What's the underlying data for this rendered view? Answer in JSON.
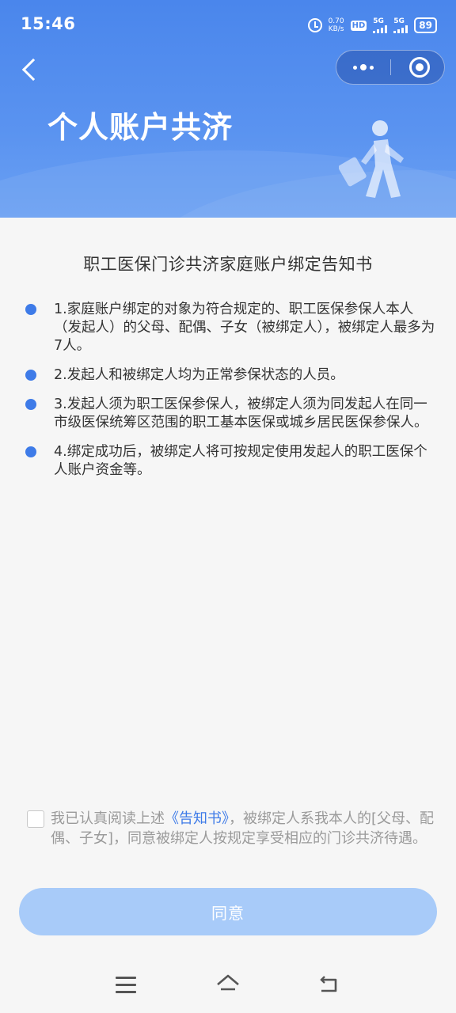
{
  "status_bar": {
    "time": "15:46",
    "net_speed_value": "0.70",
    "net_speed_unit": "KB/s",
    "hd_label": "HD",
    "sim1_label": "5G",
    "sim2_label": "5G",
    "battery": "89"
  },
  "header": {
    "title": "个人账户共济",
    "background_color": "#4a86ec"
  },
  "notice": {
    "title": "职工医保门诊共济家庭账户绑定告知书",
    "items": [
      "1.家庭账户绑定的对象为符合规定的、职工医保参保人本人（发起人）的父母、配偶、子女（被绑定人），被绑定人最多为7人。",
      "2.发起人和被绑定人均为正常参保状态的人员。",
      "3.发起人须为职工医保参保人，被绑定人须为同发起人在同一市级医保统筹区范围的职工基本医保或城乡居民医保参保人。",
      "4.绑定成功后，被绑定人将可按规定使用发起人的职工医保个人账户资金等。"
    ]
  },
  "agreement": {
    "text_before": "我已认真阅读上述",
    "link_text": "《告知书》",
    "text_after": "，被绑定人系我本人的[父母、配偶、子女]，同意被绑定人按规定享受相应的门诊共济待遇。",
    "checked": false
  },
  "primary_button": {
    "label": "同意",
    "color": "#a8cbf9"
  },
  "accent_color": "#3e7be8"
}
